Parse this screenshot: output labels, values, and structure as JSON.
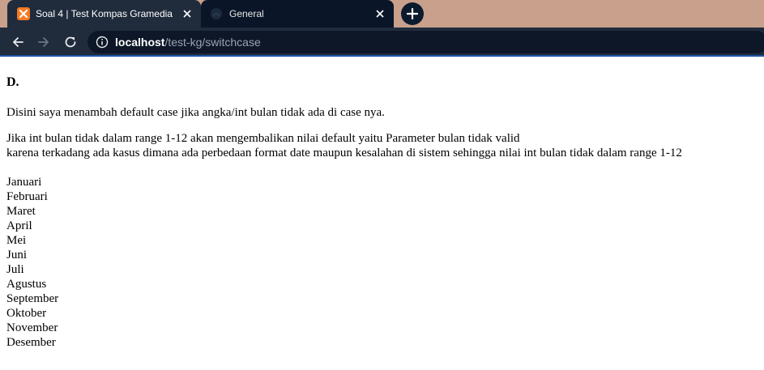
{
  "browser": {
    "tabs": [
      {
        "title": "Soal 4 | Test Kompas Gramedia",
        "favicon": "xampp-icon",
        "active": true
      },
      {
        "title": "General",
        "favicon": "github-icon",
        "active": false
      }
    ],
    "url_host": "localhost",
    "url_path": "/test-kg/switchcase",
    "colors": {
      "tabstrip": "#c8a08c",
      "toolbar": "#202b3c",
      "accent": "#1a56a8"
    }
  },
  "page": {
    "heading": "D.",
    "paragraph1": "Disini saya menambah default case jika angka/int bulan tidak ada di case nya.",
    "paragraph2_line1": "Jika int bulan tidak dalam range 1-12 akan mengembalikan nilai default yaitu Parameter bulan tidak valid",
    "paragraph2_line2": "karena terkadang ada kasus dimana ada perbedaan format date maupun kesalahan di sistem sehingga nilai int bulan tidak dalam range 1-12",
    "months": [
      "Januari",
      "Februari",
      "Maret",
      "April",
      "Mei",
      "Juni",
      "Juli",
      "Agustus",
      "September",
      "Oktober",
      "November",
      "Desember"
    ]
  }
}
